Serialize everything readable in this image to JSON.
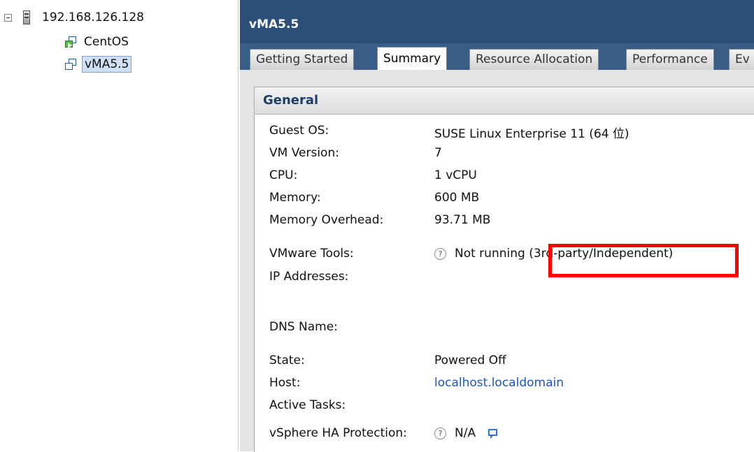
{
  "tree": {
    "host": "192.168.126.128",
    "vms": [
      {
        "name": "CentOS",
        "icon": "vm-powered-on-icon"
      },
      {
        "name": "vMA5.5",
        "icon": "vm-icon",
        "selected": true
      }
    ]
  },
  "header": {
    "title": "vMA5.5"
  },
  "tabs": [
    {
      "label": "Getting Started"
    },
    {
      "label": "Summary",
      "active": true
    },
    {
      "label": "Resource Allocation"
    },
    {
      "label": "Performance"
    },
    {
      "label": "Ev"
    }
  ],
  "general": {
    "title": "General",
    "guest_os_label": "Guest OS:",
    "guest_os_value": "SUSE Linux Enterprise 11 (64 位)",
    "vm_version_label": "VM Version:",
    "vm_version_value": "7",
    "cpu_label": "CPU:",
    "cpu_value": "1 vCPU",
    "memory_label": "Memory:",
    "memory_value": "600 MB",
    "memory_overhead_label": "Memory Overhead:",
    "memory_overhead_value": "93.71 MB",
    "vmware_tools_label": "VMware Tools:",
    "vmware_tools_value": "Not running (3rd-party/Independent)",
    "ip_addresses_label": "IP Addresses:",
    "dns_name_label": "DNS Name:",
    "state_label": "State:",
    "state_value": "Powered Off",
    "host_label": "Host:",
    "host_value": "localhost.localdomain",
    "active_tasks_label": "Active Tasks:",
    "ha_label": "vSphere HA Protection:",
    "ha_value": "N/A",
    "help_glyph": "?"
  },
  "colors": {
    "highlight": "#ff0000",
    "title_bar": "#2c4f78",
    "link": "#1a55c8"
  }
}
